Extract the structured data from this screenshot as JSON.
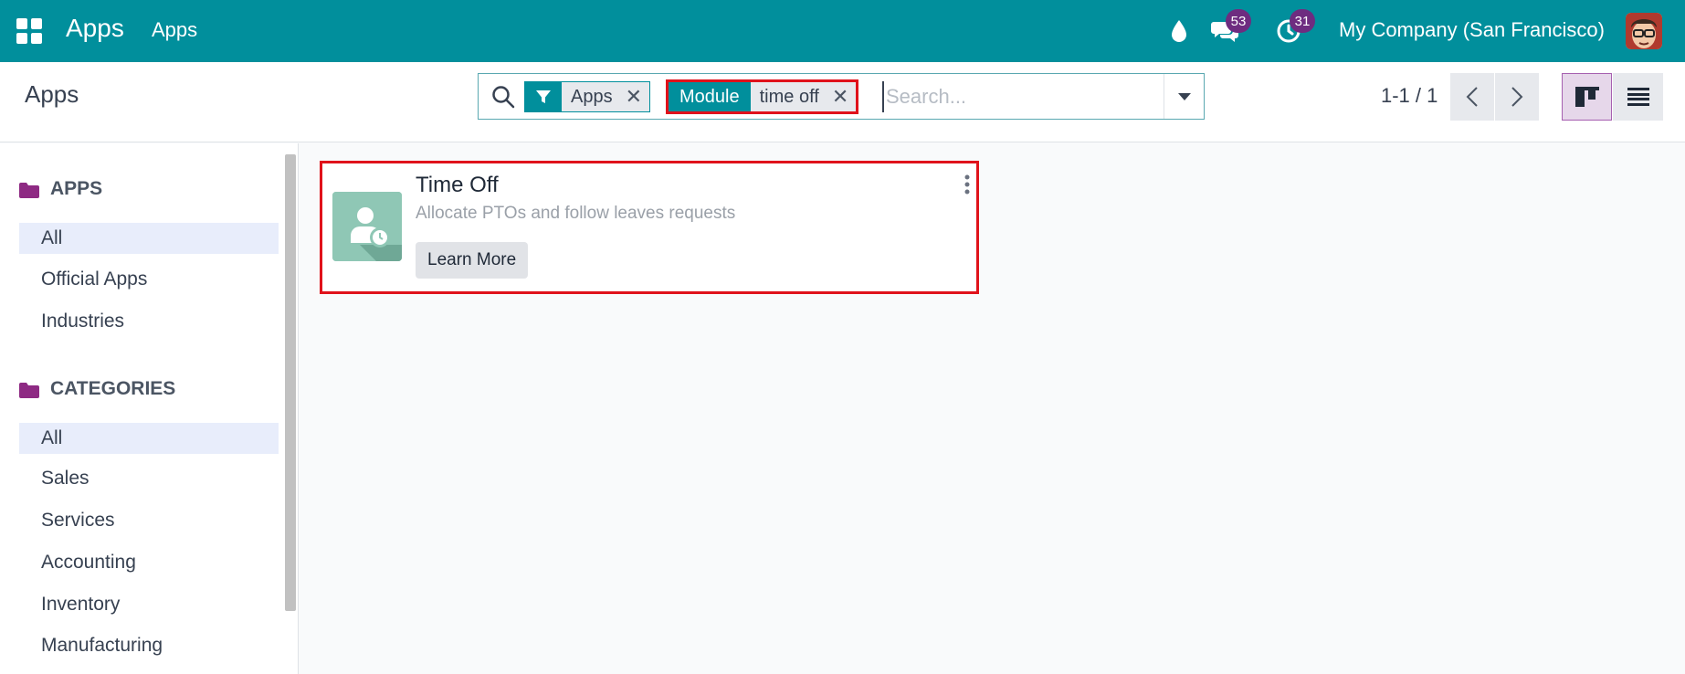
{
  "navbar": {
    "brand": "Apps",
    "menu_item": "Apps",
    "messages_count": "53",
    "activities_count": "31",
    "company": "My Company (San Francisco)",
    "bg_color": "#018f9c",
    "badge_color": "#6e2c80"
  },
  "control_panel": {
    "title": "Apps",
    "search": {
      "facets": [
        {
          "tag_icon": "filter-icon",
          "value": "Apps"
        },
        {
          "tag": "Module",
          "value": "time off"
        }
      ],
      "placeholder": "Search..."
    },
    "pager": "1-1 / 1"
  },
  "sidebar": {
    "sections": [
      {
        "title": "APPS",
        "items": [
          {
            "label": "All",
            "active": true
          },
          {
            "label": "Official Apps"
          },
          {
            "label": "Industries"
          }
        ]
      },
      {
        "title": "CATEGORIES",
        "items": [
          {
            "label": "All",
            "active": true
          },
          {
            "label": "Sales"
          },
          {
            "label": "Services"
          },
          {
            "label": "Accounting"
          },
          {
            "label": "Inventory"
          },
          {
            "label": "Manufacturing"
          }
        ]
      }
    ],
    "folder_color": "#8e2a83"
  },
  "cards": [
    {
      "title": "Time Off",
      "summary": "Allocate PTOs and follow leaves requests",
      "button": "Learn More",
      "icon": "time-off-app-icon"
    }
  ],
  "highlight_color": "#e0121b"
}
